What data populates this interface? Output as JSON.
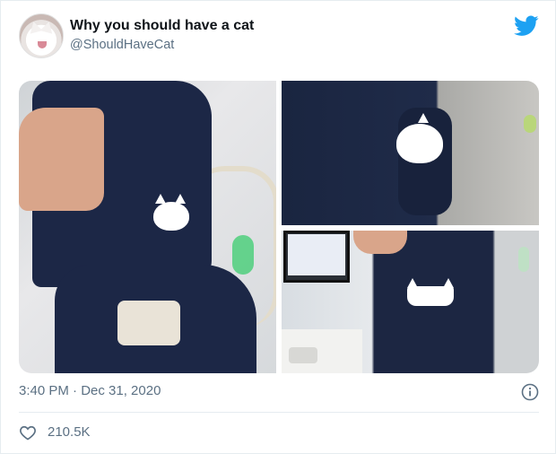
{
  "tweet": {
    "author_name": "Why you should have a cat",
    "author_handle": "@ShouldHaveCat",
    "time": "3:40 PM · Dec 31, 2020",
    "likes": "210.5K"
  },
  "icons": {
    "brand": "twitter-bird-icon",
    "info": "info-icon",
    "like": "heart-icon",
    "avatar": "avatar"
  },
  "colors": {
    "brand_blue": "#1da1f2",
    "text_primary": "#0f1419",
    "text_secondary": "#5b7083",
    "divider": "#e6ecf0"
  }
}
